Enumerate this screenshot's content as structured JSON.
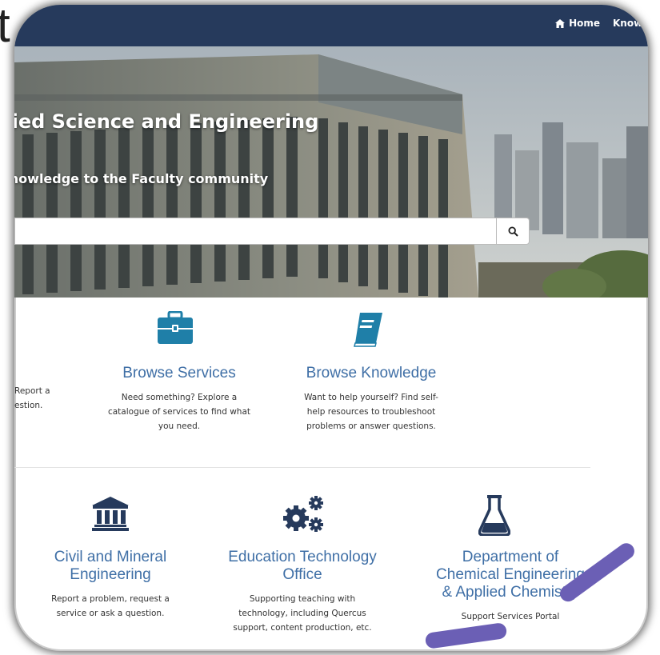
{
  "stray_text": "t",
  "nav": {
    "home_label": "Home",
    "knowledge_label": "Knowledge"
  },
  "hero": {
    "title": "Faculty of Applied Science and Engineering",
    "subtitle": "Bringing services and knowledge to the Faculty community",
    "search_placeholder": ""
  },
  "tiles_top": [
    {
      "desc_lines": [
        "Report a",
        "estion."
      ]
    },
    {
      "title": "Browse Services",
      "desc_lines": [
        "Need something? Explore a",
        "catalogue of services to find what",
        "you need."
      ]
    },
    {
      "title": "Browse Knowledge",
      "desc_lines": [
        "Want to help yourself? Find self-",
        "help resources to troubleshoot",
        "problems or answer questions."
      ]
    }
  ],
  "tiles_bottom": [
    {
      "title_lines": [
        "Civil and Mineral",
        "Engineering"
      ],
      "desc_lines": [
        "Report a problem, request a",
        "service or ask a question."
      ],
      "icon": "institution-icon"
    },
    {
      "title_lines": [
        "Education Technology",
        "Office"
      ],
      "desc_lines": [
        "Supporting teaching with",
        "technology, including Quercus",
        "support, content production, etc."
      ],
      "icon": "gears-icon"
    },
    {
      "title_lines": [
        "Department of",
        "Chemical Engineering",
        "& Applied Chemistry"
      ],
      "desc_lines": [
        "Support Services Portal"
      ],
      "icon": "flask-icon"
    }
  ],
  "colors": {
    "topbar": "#263a5c",
    "accent": "#1f7fa8",
    "link": "#3f6fa6",
    "annotation": "#6b5fb5"
  }
}
